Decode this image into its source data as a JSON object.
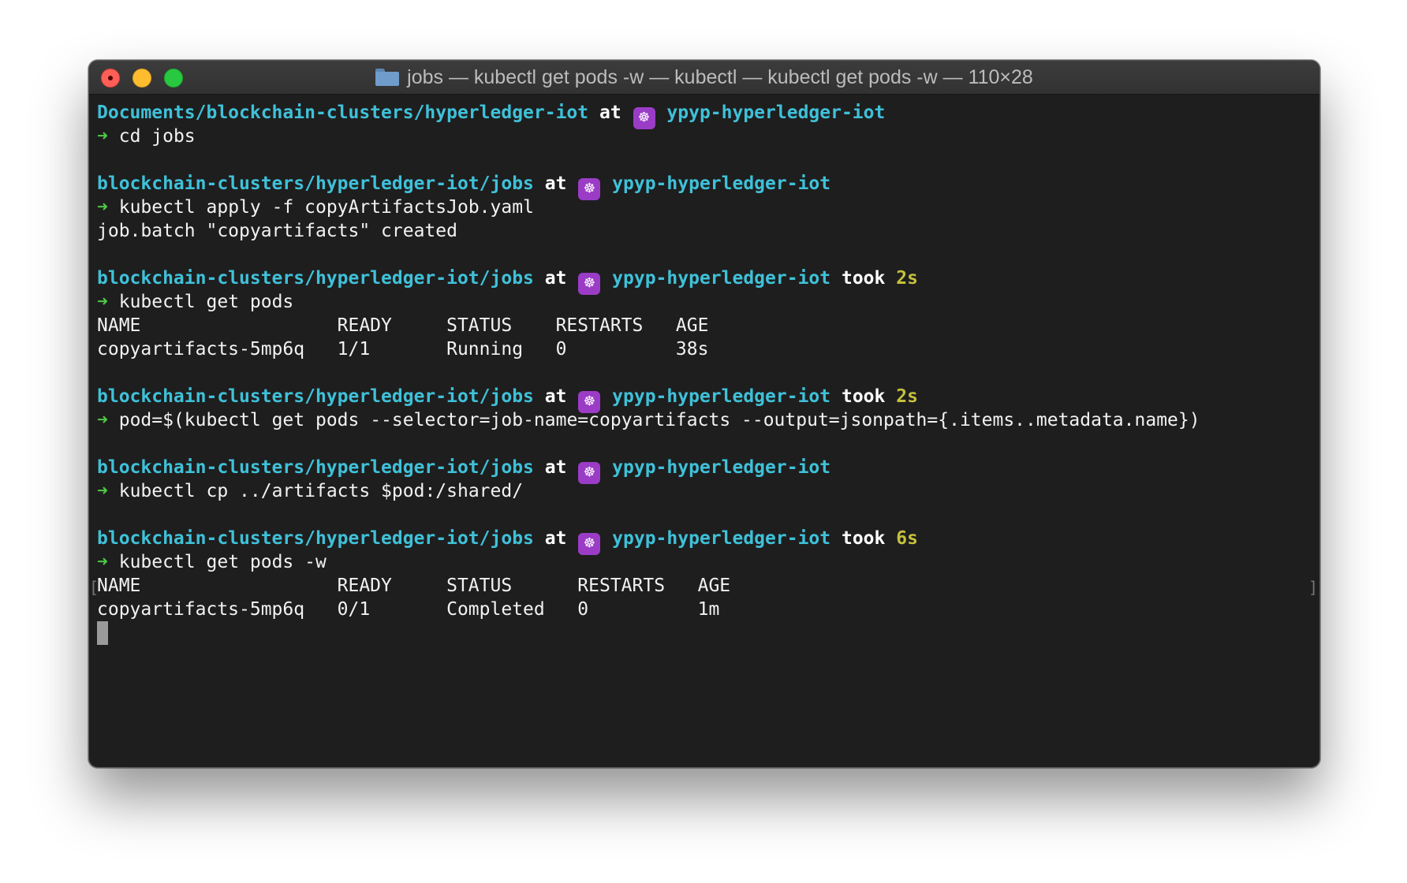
{
  "window": {
    "title": "jobs — kubectl get pods -w — kubectl — kubectl get pods -w — 110×28"
  },
  "icons": {
    "folder": "folder-icon",
    "kubernetes": "kubernetes-helm-icon",
    "kubernetes_glyph": "☸",
    "prompt_arrow": "➜"
  },
  "colors": {
    "path": "#3fc1d9",
    "arrow": "#4ec946",
    "duration": "#c5c13c",
    "k8s_badge": "#9b3cc7"
  },
  "terminal": {
    "blocks": [
      {
        "path": "Documents/blockchain-clusters/hyperledger-iot",
        "at": "at",
        "context": "ypyp-hyperledger-iot",
        "took": "",
        "duration": "",
        "command": "cd jobs",
        "output": []
      },
      {
        "path": "blockchain-clusters/hyperledger-iot/jobs",
        "at": "at",
        "context": "ypyp-hyperledger-iot",
        "took": "",
        "duration": "",
        "command": "kubectl apply -f copyArtifactsJob.yaml",
        "output": [
          "job.batch \"copyartifacts\" created"
        ]
      },
      {
        "path": "blockchain-clusters/hyperledger-iot/jobs",
        "at": "at",
        "context": "ypyp-hyperledger-iot",
        "took": "took",
        "duration": "2s",
        "command": "kubectl get pods",
        "output": [
          "NAME                  READY     STATUS    RESTARTS   AGE",
          "copyartifacts-5mp6q   1/1       Running   0          38s"
        ]
      },
      {
        "path": "blockchain-clusters/hyperledger-iot/jobs",
        "at": "at",
        "context": "ypyp-hyperledger-iot",
        "took": "took",
        "duration": "2s",
        "command": "pod=$(kubectl get pods --selector=job-name=copyartifacts --output=jsonpath={.items..metadata.name})",
        "output": []
      },
      {
        "path": "blockchain-clusters/hyperledger-iot/jobs",
        "at": "at",
        "context": "ypyp-hyperledger-iot",
        "took": "",
        "duration": "",
        "command": "kubectl cp ../artifacts $pod:/shared/",
        "output": []
      },
      {
        "path": "blockchain-clusters/hyperledger-iot/jobs",
        "at": "at",
        "context": "ypyp-hyperledger-iot",
        "took": "took",
        "duration": "6s",
        "command": "kubectl get pods -w",
        "output": [
          "NAME                  READY     STATUS      RESTARTS   AGE",
          "copyartifacts-5mp6q   0/1       Completed   0          1m"
        ]
      }
    ]
  }
}
